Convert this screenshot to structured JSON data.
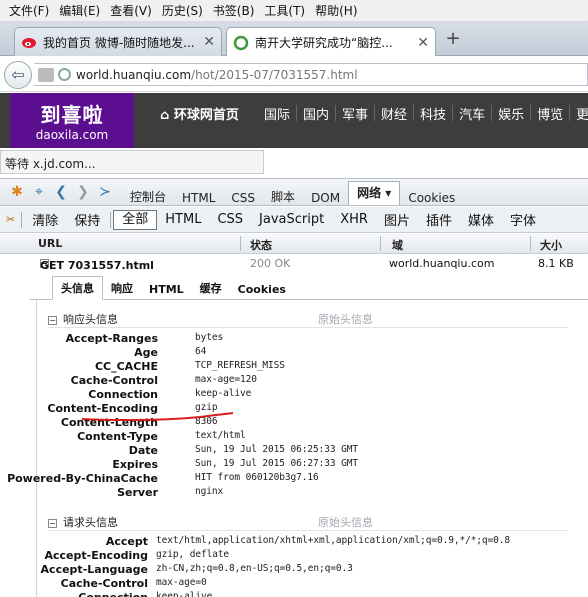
{
  "menubar": [
    "文件(F)",
    "编辑(E)",
    "查看(V)",
    "历史(S)",
    "书签(B)",
    "工具(T)",
    "帮助(H)"
  ],
  "tabs": [
    {
      "title": "我的首页 微博-随时随地发...",
      "active": false
    },
    {
      "title": "南开大学研究成功“脑控...",
      "active": true
    }
  ],
  "new_tab_label": "+",
  "url": {
    "host": "world.huanqiu.com",
    "path": "/hot/2015-07/7031557.html"
  },
  "site": {
    "logo_main": "到喜啦",
    "logo_sub": "daoxila.com",
    "home_link": "环球网首页",
    "nav": [
      "国际",
      "国内",
      "军事",
      "财经",
      "科技",
      "汽车",
      "娱乐",
      "博览",
      "更多"
    ]
  },
  "status_wait": "等待 x.jd.com...",
  "firebug": {
    "tabs": [
      "控制台",
      "HTML",
      "CSS",
      "脚本",
      "DOM",
      "网络 ▾",
      "Cookies"
    ],
    "active_tab": "网络 ▾"
  },
  "filters": {
    "actions": [
      "清除",
      "保持"
    ],
    "types": [
      "全部",
      "HTML",
      "CSS",
      "JavaScript",
      "XHR",
      "图片",
      "插件",
      "媒体",
      "字体"
    ],
    "active": "全部"
  },
  "columns": {
    "url": "URL",
    "status": "状态",
    "domain": "域",
    "size": "大小"
  },
  "request": {
    "url": "GET 7031557.html",
    "status": "200 OK",
    "domain": "world.huanqiu.com",
    "size": "8.1 KB"
  },
  "detail_tabs": [
    "头信息",
    "响应",
    "HTML",
    "缓存",
    "Cookies"
  ],
  "response_headers": {
    "title": "响应头信息",
    "raw": "原始头信息",
    "rows": [
      {
        "name": "Accept-Ranges",
        "value": "bytes"
      },
      {
        "name": "Age",
        "value": "64"
      },
      {
        "name": "CC_CACHE",
        "value": "TCP_REFRESH_MISS"
      },
      {
        "name": "Cache-Control",
        "value": "max-age=120"
      },
      {
        "name": "Connection",
        "value": "keep-alive"
      },
      {
        "name": "Content-Encoding",
        "value": "gzip"
      },
      {
        "name": "Content-Length",
        "value": "8306"
      },
      {
        "name": "Content-Type",
        "value": "text/html"
      },
      {
        "name": "Date",
        "value": "Sun, 19 Jul 2015 06:25:33 GMT"
      },
      {
        "name": "Expires",
        "value": "Sun, 19 Jul 2015 06:27:33 GMT"
      },
      {
        "name": "Powered-By-ChinaCache",
        "value": "HIT from 060120b3g7.16"
      },
      {
        "name": "Server",
        "value": "nginx"
      }
    ]
  },
  "request_headers": {
    "title": "请求头信息",
    "raw": "原始头信息",
    "rows": [
      {
        "name": "Accept",
        "value": "text/html,application/xhtml+xml,application/xml;q=0.9,*/*;q=0.8"
      },
      {
        "name": "Accept-Encoding",
        "value": "gzip, deflate"
      },
      {
        "name": "Accept-Language",
        "value": "zh-CN,zh;q=0.8,en-US;q=0.5,en;q=0.3"
      },
      {
        "name": "Cache-Control",
        "value": "max-age=0"
      },
      {
        "name": "Connection",
        "value": "keep-alive"
      }
    ]
  },
  "colors": {
    "annotation": "#d81e1e",
    "logo_bg": "#5c0e90",
    "site_bar": "#3d3d3d"
  }
}
